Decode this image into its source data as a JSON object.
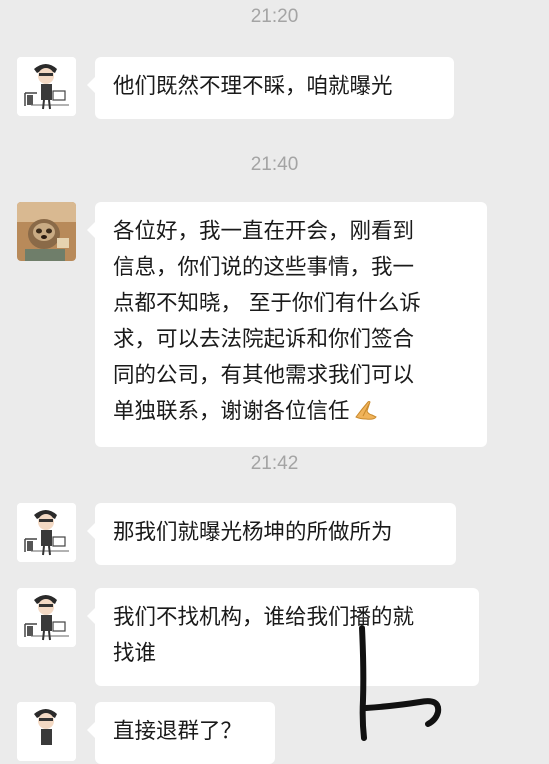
{
  "messages": [
    {
      "time": "21:20",
      "lines": [
        "他们既然不理不睬，咱就曝光"
      ]
    },
    {
      "time": "21:40",
      "lines": [
        "各位好，我一直在开会，刚看到",
        "信息，你们说的这些事情，我一",
        "点都不知晓， 至于你们有什么诉",
        "求，可以去法院起诉和你们签合",
        "同的公司，有其他需求我们可以",
        "单独联系，谢谢各位信任"
      ],
      "emoji": "praying-hands-icon"
    },
    {
      "time": "21:42",
      "lines": [
        "那我们就曝光杨坤的所做所为"
      ]
    },
    {
      "lines": [
        "我们不找机构，谁给我们播的就",
        "找谁"
      ]
    },
    {
      "lines": [
        "直接退群了？"
      ]
    }
  ]
}
